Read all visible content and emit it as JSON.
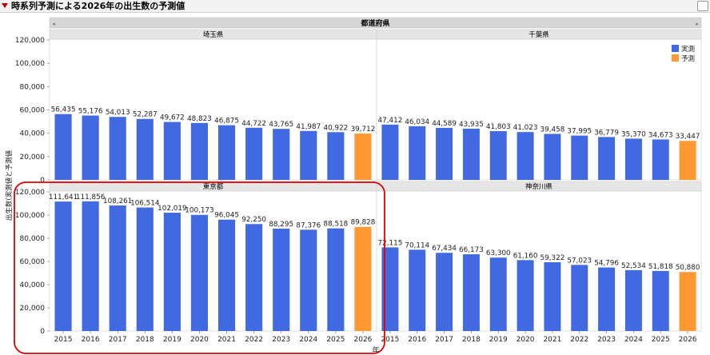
{
  "window": {
    "title": "時系列予測による2026年の出生数の予測値"
  },
  "chart_data": {
    "type": "bar",
    "group_header": "都道府県",
    "xlabel": "年",
    "ylabel": "出生数(実測値と予測値",
    "ylim": [
      0,
      120000
    ],
    "yticks": [
      "0",
      "20,000",
      "40,000",
      "60,000",
      "80,000",
      "100,000",
      "120,000"
    ],
    "categories": [
      "2015",
      "2016",
      "2017",
      "2018",
      "2019",
      "2020",
      "2021",
      "2022",
      "2023",
      "2024",
      "2025",
      "2026"
    ],
    "legend": {
      "position": "top-right",
      "items": [
        {
          "name": "実測",
          "color": "#4169e1"
        },
        {
          "name": "予測",
          "color": "#ff9933"
        }
      ]
    },
    "panels": [
      {
        "name": "埼玉県",
        "values": [
          56435,
          55176,
          54013,
          52287,
          49672,
          48823,
          46875,
          44722,
          43765,
          41987,
          40922,
          39712
        ],
        "labels": [
          "56,435",
          "55,176",
          "54,013",
          "52,287",
          "49,672",
          "48,823",
          "46,875",
          "44,722",
          "43,765",
          "41,987",
          "40,922",
          "39,712"
        ],
        "types": [
          "実測",
          "実測",
          "実測",
          "実測",
          "実測",
          "実測",
          "実測",
          "実測",
          "実測",
          "実測",
          "実測",
          "予測"
        ]
      },
      {
        "name": "千葉県",
        "values": [
          47412,
          46034,
          44589,
          43935,
          41803,
          41023,
          39458,
          37995,
          36779,
          35370,
          34673,
          33447
        ],
        "labels": [
          "47,412",
          "46,034",
          "44,589",
          "43,935",
          "41,803",
          "41,023",
          "39,458",
          "37,995",
          "36,779",
          "35,370",
          "34,673",
          "33,447"
        ],
        "types": [
          "実測",
          "実測",
          "実測",
          "実測",
          "実測",
          "実測",
          "実測",
          "実測",
          "実測",
          "実測",
          "実測",
          "予測"
        ]
      },
      {
        "name": "東京都",
        "values": [
          111641,
          111856,
          108261,
          106514,
          102019,
          100173,
          96045,
          92250,
          88295,
          87376,
          88518,
          89828
        ],
        "labels": [
          "111,641",
          "111,856",
          "108,261",
          "106,514",
          "102,019",
          "100,173",
          "96,045",
          "92,250",
          "88,295",
          "87,376",
          "88,518",
          "89,828"
        ],
        "types": [
          "実測",
          "実測",
          "実測",
          "実測",
          "実測",
          "実測",
          "実測",
          "実測",
          "実測",
          "実測",
          "実測",
          "予測"
        ]
      },
      {
        "name": "神奈川県",
        "values": [
          72115,
          70114,
          67434,
          66173,
          63300,
          61160,
          59322,
          57023,
          54796,
          52534,
          51818,
          50880
        ],
        "labels": [
          "72,115",
          "70,114",
          "67,434",
          "66,173",
          "63,300",
          "61,160",
          "59,322",
          "57,023",
          "54,796",
          "52,534",
          "51,818",
          "50,880"
        ],
        "types": [
          "実測",
          "実測",
          "実測",
          "実測",
          "実測",
          "実測",
          "実測",
          "実測",
          "実測",
          "実測",
          "実測",
          "予測"
        ]
      }
    ],
    "highlight": {
      "panel": "東京都",
      "color": "#e00000"
    }
  }
}
